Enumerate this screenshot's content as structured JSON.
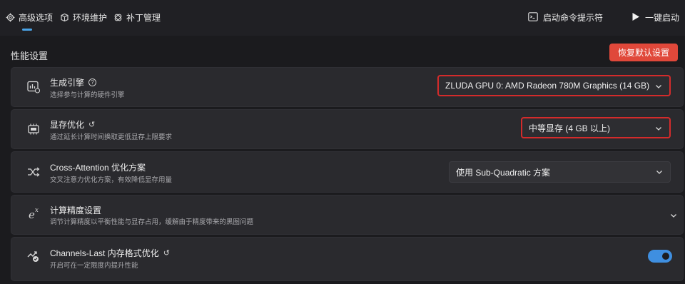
{
  "tabs": [
    {
      "label": "高级选项",
      "icon": "gear-icon",
      "active": true
    },
    {
      "label": "环境维护",
      "icon": "package-icon",
      "active": false
    },
    {
      "label": "补丁管理",
      "icon": "patch-icon",
      "active": false
    }
  ],
  "header_actions": {
    "terminal_label": "启动命令提示符",
    "terminal_icon": "terminal-icon",
    "launch_label": "一键启动",
    "launch_icon": "play-icon"
  },
  "section_title": "性能设置",
  "reset_button": "恢复默认设置",
  "settings": [
    {
      "icon": "engine-icon",
      "title": "生成引擎",
      "has_help": true,
      "subtitle": "选择参与计算的硬件引擎",
      "control": "dropdown",
      "value": "ZLUDA GPU 0: AMD Radeon 780M Graphics (14 GB)",
      "highlighted": true
    },
    {
      "icon": "memory-chip-icon",
      "title": "显存优化",
      "has_reset": true,
      "subtitle": "通过延长计算时间换取更低显存上限要求",
      "control": "dropdown",
      "value": "中等显存 (4 GB 以上)",
      "highlighted": true
    },
    {
      "icon": "shuffle-icon",
      "title": "Cross-Attention 优化方案",
      "subtitle": "交叉注意力优化方案，有效降低显存用量",
      "control": "dropdown",
      "value": "使用 Sub-Quadratic 方案",
      "highlighted": false
    },
    {
      "icon": "exponent-icon",
      "title": "计算精度设置",
      "subtitle": "调节计算精度以平衡性能与显存占用，缓解由于精度带来的黑图问题",
      "control": "expander"
    },
    {
      "icon": "trend-check-icon",
      "title": "Channels-Last 内存格式优化",
      "has_reset": true,
      "subtitle": "开启可在一定限度内提升性能",
      "control": "toggle",
      "value": true
    }
  ],
  "colors": {
    "accent": "#4aa3e6",
    "danger": "#e0483a",
    "highlight_border": "#d42b2b",
    "toggle_on": "#3f8fe0"
  }
}
